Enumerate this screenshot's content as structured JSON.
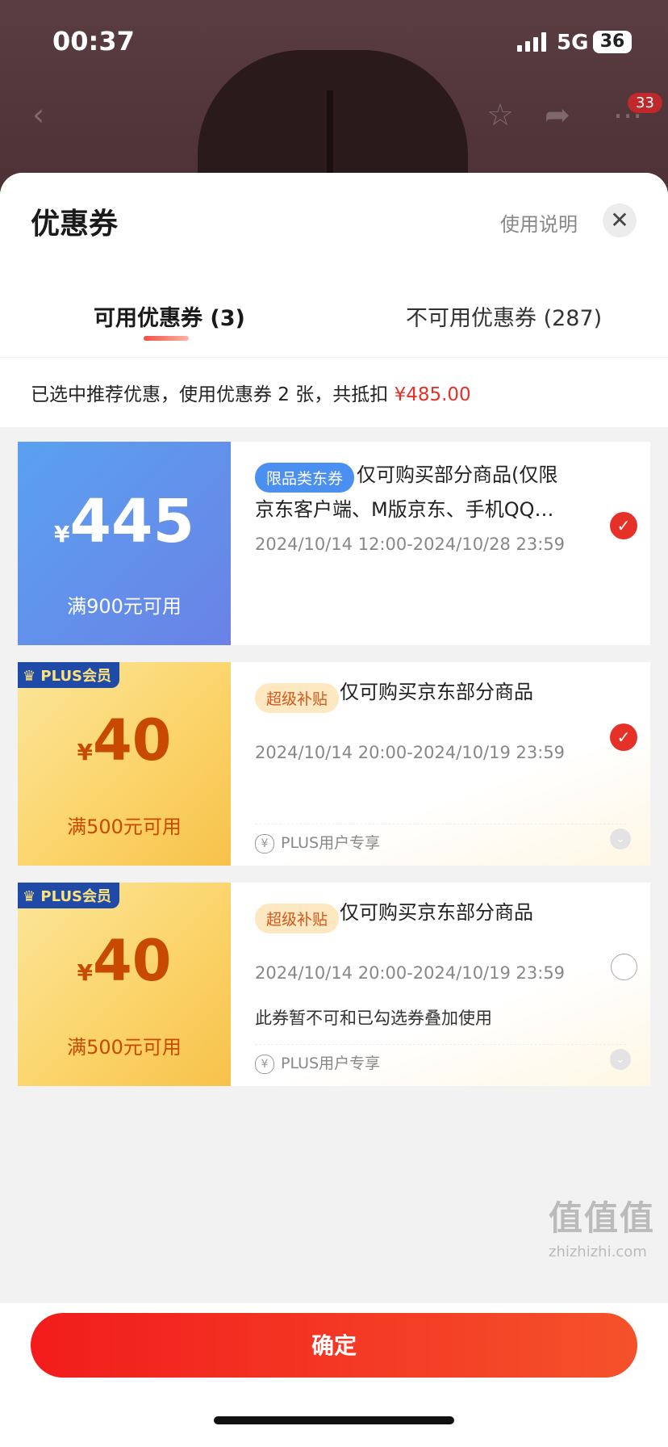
{
  "status_bar": {
    "time": "00:37",
    "network": "5G",
    "battery": "36"
  },
  "product_nav": {
    "cart_badge": "33"
  },
  "sheet": {
    "title": "优惠券",
    "help_label": "使用说明",
    "tabs": [
      {
        "label": "可用优惠券 (3)",
        "active": true
      },
      {
        "label": "不可用优惠券 (287)",
        "active": false
      }
    ],
    "summary": {
      "text": "已选中推荐优惠，使用优惠券 2 张，共抵扣 ",
      "amount": "¥485.00"
    }
  },
  "coupons": [
    {
      "currency": "¥",
      "amount": "445",
      "condition": "满900元可用",
      "tag": "限品类东券",
      "desc_line1": "仅可购买部分商品(仅限",
      "desc_line2": "京东客户端、M版京东、手机QQ…",
      "date": "2024/10/14 12:00-2024/10/28 23:59",
      "selected": true
    },
    {
      "badge": "PLUS会员",
      "currency": "¥",
      "amount": "40",
      "condition": "满500元可用",
      "tag": "超级补贴",
      "desc": "仅可购买京东部分商品",
      "date": "2024/10/14 20:00-2024/10/19 23:59",
      "footer": "PLUS用户专享",
      "selected": true
    },
    {
      "badge": "PLUS会员",
      "currency": "¥",
      "amount": "40",
      "condition": "满500元可用",
      "tag": "超级补贴",
      "desc": "仅可购买京东部分商品",
      "date": "2024/10/14 20:00-2024/10/19 23:59",
      "note": "此券暂不可和已勾选券叠加使用",
      "footer": "PLUS用户专享",
      "selected": false
    }
  ],
  "confirm_label": "确定",
  "watermark": {
    "logo": "值值值",
    "url": "zhizhizhi.com"
  },
  "colors": {
    "accent": "#e63129",
    "blue_coupon": "#5a8fe8",
    "gold_coupon": "#fbd46a"
  }
}
